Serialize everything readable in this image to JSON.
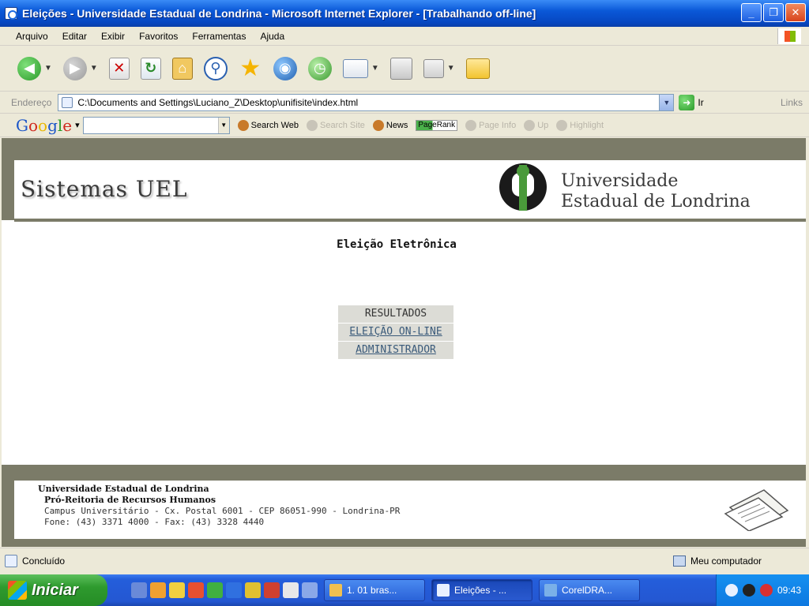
{
  "window": {
    "title": "Eleições - Universidade Estadual de Londrina - Microsoft Internet Explorer - [Trabalhando off-line]"
  },
  "menubar": {
    "items": [
      "Arquivo",
      "Editar",
      "Exibir",
      "Favoritos",
      "Ferramentas",
      "Ajuda"
    ]
  },
  "addressbar": {
    "label": "Endereço",
    "url": "C:\\Documents and Settings\\Luciano_Z\\Desktop\\unifisite\\index.html",
    "go_label": "Ir",
    "links_label": "Links"
  },
  "googlebar": {
    "logo": "Google",
    "search_web_label": "Search Web",
    "search_site_label": "Search Site",
    "news_label": "News",
    "pagerank_label": "PageRank",
    "page_info_label": "Page Info",
    "up_label": "Up",
    "highlight_label": "Highlight"
  },
  "page": {
    "brand": "Sistemas UEL",
    "university_line1": "Universidade",
    "university_line2": "Estadual de Londrina",
    "title": "Eleição Eletrônica",
    "menu": [
      {
        "label": "RESULTADOS"
      },
      {
        "label": "ELEIÇÃO ON-LINE"
      },
      {
        "label": "ADMINISTRADOR"
      }
    ],
    "footer": {
      "line1": "Universidade Estadual de Londrina",
      "line2": "Pró-Reitoria de Recursos Humanos",
      "line3": "Campus Universitário - Cx. Postal 6001 - CEP 86051-990 - Londrina-PR",
      "line4": "Fone: (43) 3371 4000 - Fax: (43) 3328 4440"
    }
  },
  "statusbar": {
    "status": "Concluído",
    "zone": "Meu computador"
  },
  "taskbar": {
    "start_label": "Iniciar",
    "tasks": [
      {
        "label": "1. 01 bras..."
      },
      {
        "label": "Eleições - ..."
      },
      {
        "label": "CorelDRA..."
      }
    ],
    "clock": "09:43"
  }
}
